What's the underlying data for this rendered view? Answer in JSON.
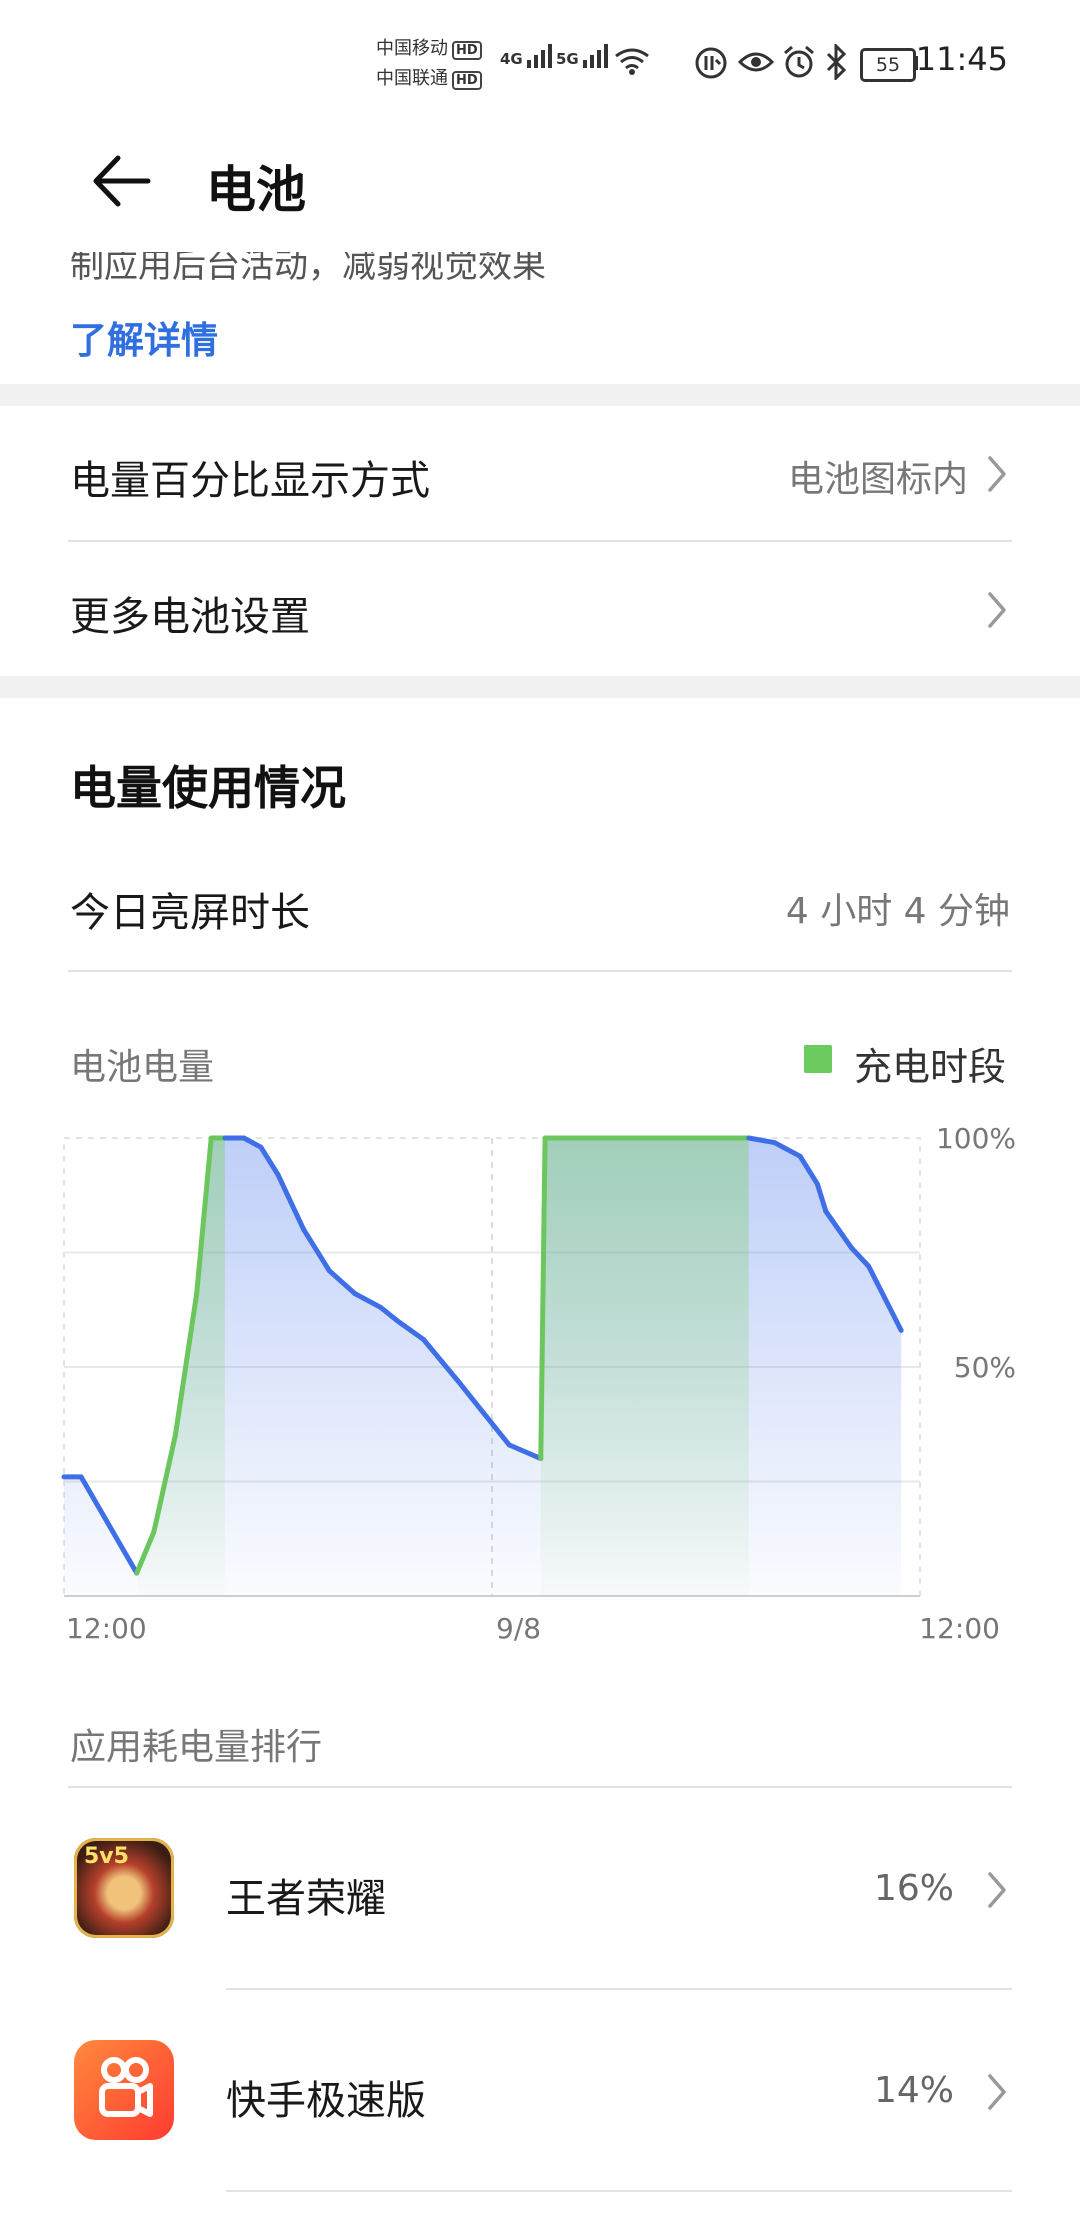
{
  "status_bar": {
    "carrier1": "中国移动",
    "carrier2": "中国联通",
    "hd": "HD",
    "net1": "4G",
    "net2": "5G",
    "battery_level": "55",
    "time": "11:45"
  },
  "header": {
    "title": "电池"
  },
  "intro": {
    "cut_text": "制应用后台活动，减弱视觉效果",
    "learn_more": "了解详情"
  },
  "settings": [
    {
      "label": "电量百分比显示方式",
      "value": "电池图标内"
    },
    {
      "label": "更多电池设置",
      "value": ""
    }
  ],
  "usage": {
    "section_title": "电量使用情况",
    "screen_time_label": "今日亮屏时长",
    "screen_time_value": "4 小时 4 分钟"
  },
  "chart_header": {
    "label": "电池电量",
    "legend": "充电时段"
  },
  "chart_data": {
    "type": "area",
    "x": [
      "12:00",
      "9/8",
      "12:00"
    ],
    "ytick_labels": [
      "100%",
      "50%"
    ],
    "ylim": [
      0,
      100
    ],
    "colors": {
      "discharge": "#3f6fe6",
      "charge": "#6bc75d"
    },
    "grid": true,
    "series": [
      {
        "points": [
          [
            0.0,
            26
          ],
          [
            0.02,
            26
          ],
          [
            0.085,
            5
          ],
          [
            0.105,
            14
          ],
          [
            0.13,
            35
          ],
          [
            0.155,
            66
          ],
          [
            0.172,
            100
          ],
          [
            0.188,
            100
          ],
          [
            0.21,
            100
          ],
          [
            0.23,
            98
          ],
          [
            0.25,
            92
          ],
          [
            0.28,
            80
          ],
          [
            0.31,
            71
          ],
          [
            0.34,
            66
          ],
          [
            0.37,
            63
          ],
          [
            0.39,
            60
          ],
          [
            0.42,
            56
          ],
          [
            0.46,
            47
          ],
          [
            0.49,
            40
          ],
          [
            0.52,
            33
          ],
          [
            0.557,
            30
          ],
          [
            0.562,
            100
          ],
          [
            0.8,
            100
          ],
          [
            0.83,
            99
          ],
          [
            0.86,
            96
          ],
          [
            0.88,
            90
          ],
          [
            0.89,
            84
          ],
          [
            0.92,
            76
          ],
          [
            0.94,
            72
          ],
          [
            0.978,
            58
          ]
        ],
        "charging_segments": [
          [
            0.085,
            0.188
          ],
          [
            0.557,
            0.8
          ]
        ]
      }
    ]
  },
  "app_ranking": {
    "title": "应用耗电量排行",
    "apps": [
      {
        "name": "王者荣耀",
        "percent": "16%",
        "icon": "game-5v5-icon"
      },
      {
        "name": "快手极速版",
        "percent": "14%",
        "icon": "kuaishou-icon"
      }
    ]
  }
}
